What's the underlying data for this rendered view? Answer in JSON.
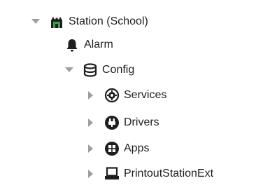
{
  "tree": {
    "root": {
      "label": "Station (School)",
      "icon": "station-icon",
      "expanded": true,
      "children": {
        "alarm": {
          "label": "Alarm",
          "icon": "bell-icon",
          "expandable": false
        },
        "config": {
          "label": "Config",
          "icon": "database-icon",
          "expanded": true,
          "children": {
            "services": {
              "label": "Services",
              "icon": "services-icon",
              "expanded": false
            },
            "drivers": {
              "label": "Drivers",
              "icon": "drivers-icon",
              "expanded": false
            },
            "apps": {
              "label": "Apps",
              "icon": "apps-icon",
              "expanded": false
            },
            "printout": {
              "label": "PrintoutStationExt",
              "icon": "printer-icon",
              "expanded": false
            }
          }
        }
      }
    }
  },
  "colors": {
    "text": "#1e1e1e",
    "icon": "#1e1e1e",
    "toggle": "#9e9e9e",
    "station_green": "#3ba24a"
  }
}
